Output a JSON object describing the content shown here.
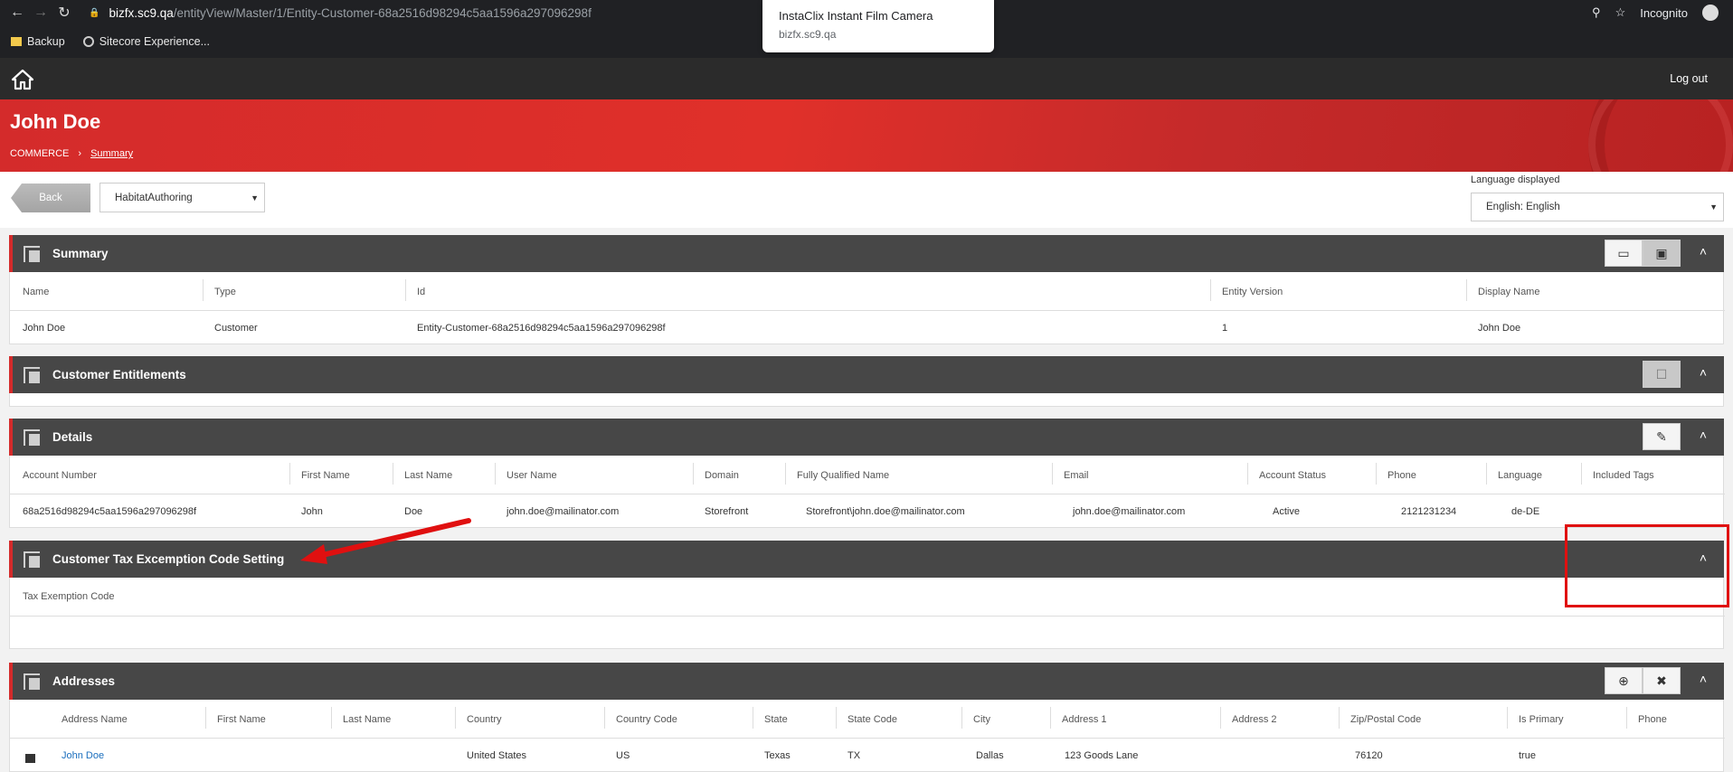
{
  "browser": {
    "url_host": "bizfx.sc9.qa",
    "url_path": "/entityView/Master/1/Entity-Customer-68a2516d98294c5aa1596a297096298f",
    "incognito_label": "Incognito",
    "tooltip_title": "InstaClix Instant Film Camera",
    "tooltip_host": "bizfx.sc9.qa",
    "bookmarks": [
      "Backup",
      "Sitecore Experience..."
    ]
  },
  "topbar": {
    "logout": "Log out"
  },
  "hero": {
    "title": "John Doe",
    "breadcrumb_root": "COMMERCE",
    "breadcrumb_current": "Summary"
  },
  "toolbar": {
    "back": "Back",
    "environment": "HabitatAuthoring",
    "language_label": "Language displayed",
    "language_value": "English: English"
  },
  "summary": {
    "title": "Summary",
    "headers": [
      "Name",
      "Type",
      "Id",
      "Entity Version",
      "Display Name"
    ],
    "row": [
      "John Doe",
      "Customer",
      "Entity-Customer-68a2516d98294c5aa1596a297096298f",
      "1",
      "John Doe"
    ]
  },
  "entitlements": {
    "title": "Customer Entitlements"
  },
  "details": {
    "title": "Details",
    "headers": [
      "Account Number",
      "First Name",
      "Last Name",
      "User Name",
      "Domain",
      "Fully Qualified Name",
      "Email",
      "Account Status",
      "Phone",
      "Language",
      "Included Tags"
    ],
    "row": [
      "68a2516d98294c5aa1596a297096298f",
      "John",
      "Doe",
      "john.doe@mailinator.com",
      "Storefront",
      "Storefront\\john.doe@mailinator.com",
      "john.doe@mailinator.com",
      "Active",
      "2121231234",
      "de-DE",
      ""
    ]
  },
  "tax": {
    "title": "Customer Tax Excemption Code Setting",
    "headers": [
      "Tax Exemption Code"
    ]
  },
  "addresses": {
    "title": "Addresses",
    "headers": [
      "Address Name",
      "First Name",
      "Last Name",
      "Country",
      "Country Code",
      "State",
      "State Code",
      "City",
      "Address 1",
      "Address 2",
      "Zip/Postal Code",
      "Is Primary",
      "Phone"
    ],
    "row": [
      "John Doe",
      "",
      "",
      "United States",
      "US",
      "Texas",
      "TX",
      "Dallas",
      "123 Goods Lane",
      "",
      "76120",
      "true",
      ""
    ]
  }
}
